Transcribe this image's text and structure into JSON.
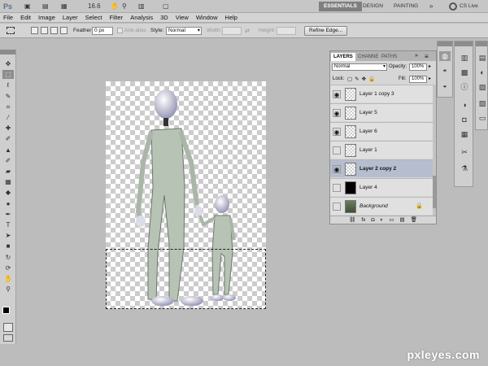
{
  "appbar": {
    "logo": "Ps",
    "zoom": "16.6",
    "workspaces": [
      "ESSENTIALS",
      "DESIGN",
      "PAINTING"
    ],
    "more": "»",
    "cs_live": "CS Live"
  },
  "menu": [
    "File",
    "Edit",
    "Image",
    "Layer",
    "Select",
    "Filter",
    "Analysis",
    "3D",
    "View",
    "Window",
    "Help"
  ],
  "options": {
    "feather_label": "Feather:",
    "feather_value": "0 px",
    "antialias_label": "Anti-alias",
    "style_label": "Style:",
    "style_value": "Normal",
    "width_label": "Width:",
    "height_label": "Height:",
    "refine_edge": "Refine Edge..."
  },
  "tools": [
    {
      "icon": "move-icon",
      "glyph": "✥"
    },
    {
      "icon": "marquee-icon",
      "glyph": "⬚"
    },
    {
      "icon": "lasso-icon",
      "glyph": "ℓ"
    },
    {
      "icon": "quick-select-icon",
      "glyph": "✎"
    },
    {
      "icon": "crop-icon",
      "glyph": "⌗"
    },
    {
      "icon": "eyedropper-icon",
      "glyph": "⁄"
    },
    {
      "icon": "healing-icon",
      "glyph": "✚"
    },
    {
      "icon": "brush-icon",
      "glyph": "✐"
    },
    {
      "icon": "stamp-icon",
      "glyph": "▲"
    },
    {
      "icon": "history-brush-icon",
      "glyph": "✐"
    },
    {
      "icon": "eraser-icon",
      "glyph": "▰"
    },
    {
      "icon": "gradient-icon",
      "glyph": "▦"
    },
    {
      "icon": "blur-icon",
      "glyph": "◆"
    },
    {
      "icon": "dodge-icon",
      "glyph": "●"
    },
    {
      "icon": "pen-icon",
      "glyph": "✒"
    },
    {
      "icon": "type-icon",
      "glyph": "T"
    },
    {
      "icon": "path-select-icon",
      "glyph": "➤"
    },
    {
      "icon": "shape-icon",
      "glyph": "■"
    },
    {
      "icon": "3d-rotate-icon",
      "glyph": "↻"
    },
    {
      "icon": "3d-orbit-icon",
      "glyph": "⟳"
    },
    {
      "icon": "hand-icon",
      "glyph": "✋"
    },
    {
      "icon": "zoom-icon",
      "glyph": "⚲"
    }
  ],
  "layers_panel": {
    "tabs": [
      "LAYERS",
      "CHANNE",
      "PATHS"
    ],
    "menu_glyph": "≡",
    "blend_mode": "Normal",
    "opacity_label": "Opacity:",
    "opacity_value": "100%",
    "lock_label": "Lock:",
    "fill_label": "Fill:",
    "fill_value": "100%",
    "layers": [
      {
        "name": "Layer 1 copy 3",
        "visible": true,
        "selected": false,
        "thumb": "transparent"
      },
      {
        "name": "Layer 5",
        "visible": true,
        "selected": false,
        "thumb": "transparent"
      },
      {
        "name": "Layer 6",
        "visible": true,
        "selected": false,
        "thumb": "transparent"
      },
      {
        "name": "Layer 1",
        "visible": false,
        "selected": false,
        "thumb": "transparent"
      },
      {
        "name": "Layer 2 copy 2",
        "visible": true,
        "selected": true,
        "thumb": "transparent"
      },
      {
        "name": "Layer 4",
        "visible": false,
        "selected": false,
        "thumb": "black"
      },
      {
        "name": "Background",
        "visible": false,
        "selected": false,
        "thumb": "photo"
      }
    ],
    "footer_glyphs": [
      "⛓",
      "fx",
      "◘",
      "◐",
      "▭",
      "▤",
      "🗑"
    ]
  },
  "watermark": "pxleyes.com",
  "colors": {
    "selected_layer": "#b6bdcf",
    "active_workspace": "#7f7f7f"
  }
}
